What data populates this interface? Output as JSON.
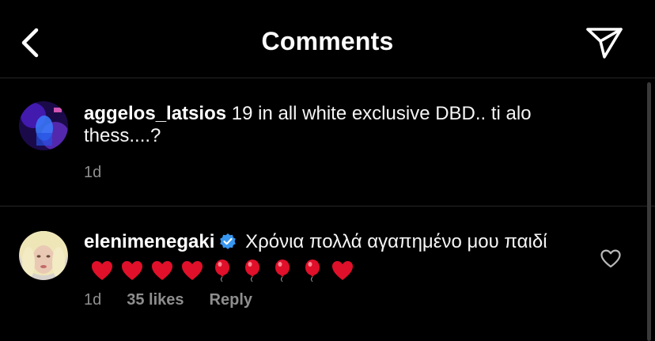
{
  "header": {
    "title": "Comments"
  },
  "comments": [
    {
      "username": "aggelos_latsios",
      "text": "19 in all white exclusive DBD.. ti alo thess....?",
      "time": "1d"
    },
    {
      "username": "elenimenegaki",
      "verified": true,
      "text": "Χρόνια πολλά αγαπημένο μου παιδί",
      "emojis": [
        "heart",
        "heart",
        "heart",
        "heart",
        "balloon",
        "balloon",
        "balloon",
        "balloon",
        "heart"
      ],
      "time": "1d",
      "likes": "35 likes",
      "reply_label": "Reply"
    }
  ],
  "icons": {
    "back": "chevron-left-icon",
    "send": "paper-plane-icon",
    "like": "heart-outline-icon"
  },
  "colors": {
    "background": "#000000",
    "text": "#ffffff",
    "secondary_text": "#8e8e8e",
    "verified_badge": "#3897f0",
    "heart_emoji": "#e0102a"
  }
}
